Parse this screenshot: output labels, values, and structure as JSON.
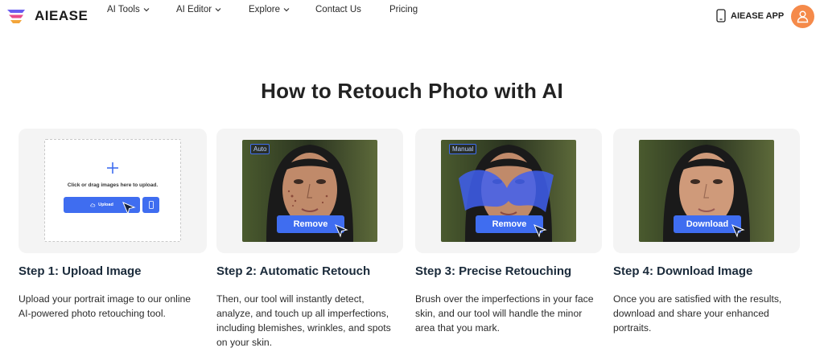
{
  "brand": {
    "name": "AIEASE"
  },
  "nav": {
    "items": [
      {
        "label": "AI Tools",
        "has_dropdown": true
      },
      {
        "label": "AI Editor",
        "has_dropdown": true
      },
      {
        "label": "Explore",
        "has_dropdown": true
      },
      {
        "label": "Contact Us",
        "has_dropdown": false
      },
      {
        "label": "Pricing",
        "has_dropdown": false
      }
    ],
    "app_button": "AIEASE APP",
    "avatar_icon": "user-icon"
  },
  "page": {
    "title": "How to Retouch Photo with AI"
  },
  "upload_card": {
    "prompt": "Click or drag images here to upload.",
    "upload_label": "Upload"
  },
  "cards": [
    {
      "badge": "Auto",
      "action": "Remove"
    },
    {
      "badge": "Manual",
      "action": "Remove"
    },
    {
      "badge": "",
      "action": "Download"
    }
  ],
  "steps": [
    {
      "title": "Step 1: Upload Image",
      "description": "Upload your portrait image to our online AI-powered photo retouching tool."
    },
    {
      "title": "Step 2: Automatic Retouch",
      "description": "Then, our tool will instantly detect, analyze, and touch up all imperfections, including blemishes, wrinkles, and spots on your skin."
    },
    {
      "title": "Step 3: Precise Retouching",
      "description": "Brush over the imperfections in your face skin, and our tool will handle the minor area that you mark."
    },
    {
      "title": "Step 4: Download Image",
      "description": "Once you are satisfied with the results, download and share your enhanced portraits."
    }
  ],
  "colors": {
    "accent": "#3f6df0",
    "avatar": "#f58a4a",
    "card_bg": "#f4f4f4"
  }
}
